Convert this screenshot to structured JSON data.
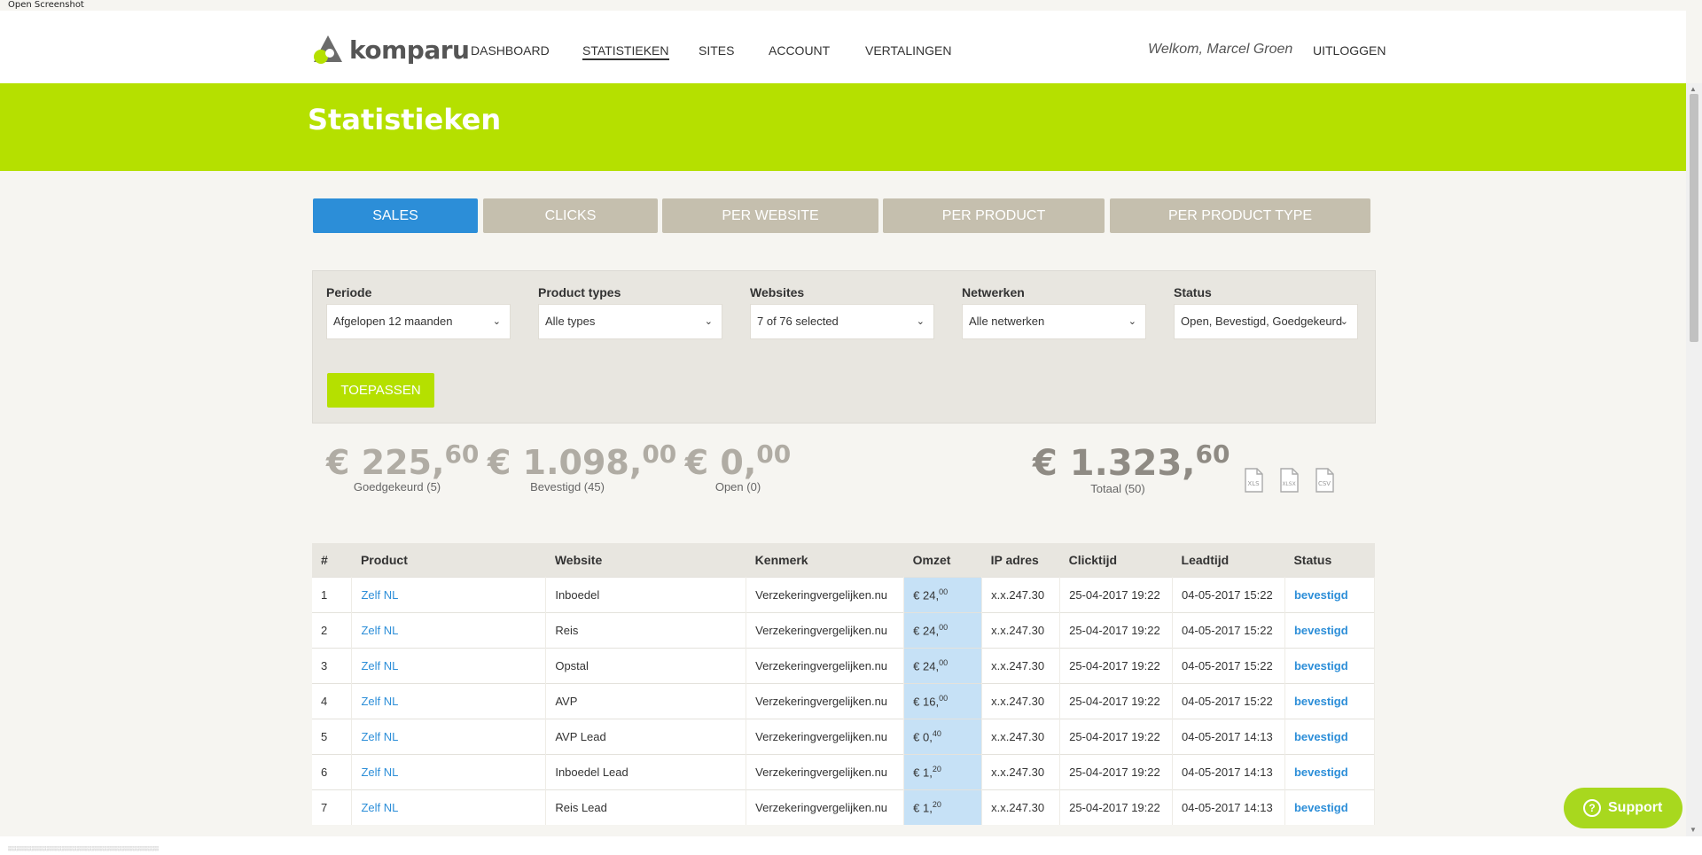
{
  "screenshot_caption": "Open Screenshot",
  "logo": {
    "text": "komparu"
  },
  "nav": {
    "items": [
      {
        "label": "DASHBOARD"
      },
      {
        "label": "STATISTIEKEN"
      },
      {
        "label": "SITES"
      },
      {
        "label": "ACCOUNT"
      },
      {
        "label": "VERTALINGEN"
      }
    ],
    "welcome": "Welkom, Marcel Groen",
    "logout": "UITLOGGEN"
  },
  "page_title": "Statistieken",
  "tabs": [
    {
      "label": "SALES"
    },
    {
      "label": "CLICKS"
    },
    {
      "label": "PER WEBSITE"
    },
    {
      "label": "PER PRODUCT"
    },
    {
      "label": "PER PRODUCT TYPE"
    }
  ],
  "filters": [
    {
      "label": "Periode",
      "value": "Afgelopen 12 maanden"
    },
    {
      "label": "Product types",
      "value": "Alle types"
    },
    {
      "label": "Websites",
      "value": "7 of 76 selected"
    },
    {
      "label": "Netwerken",
      "value": "Alle netwerken"
    },
    {
      "label": "Status",
      "value": "Open, Bevestigd, Goedgekeurd"
    }
  ],
  "apply_label": "TOEPASSEN",
  "summary": [
    {
      "main": "€ 225,",
      "cents": "60",
      "caption": "Goedgekeurd (5)"
    },
    {
      "main": "€ 1.098,",
      "cents": "00",
      "caption": "Bevestigd (45)"
    },
    {
      "main": "€ 0,",
      "cents": "00",
      "caption": "Open (0)"
    },
    {
      "main": "€ 1.323,",
      "cents": "60",
      "caption": "Totaal (50)"
    }
  ],
  "downloads": [
    {
      "label": "XLS"
    },
    {
      "label": "XLSX"
    },
    {
      "label": "CSV"
    }
  ],
  "table": {
    "headers": [
      "#",
      "Product",
      "Website",
      "Kenmerk",
      "Omzet",
      "IP adres",
      "Clicktijd",
      "Leadtijd",
      "Status"
    ],
    "rows": [
      {
        "num": "1",
        "product": "Zelf NL",
        "website": "Inboedel",
        "kenmerk": "Verzekeringvergelijken.nu",
        "omzet": "€ 24,",
        "omzet_cents": "00",
        "ip": "x.x.247.30",
        "click": "25-04-2017 19:22",
        "lead": "04-05-2017 15:22",
        "status": "bevestigd"
      },
      {
        "num": "2",
        "product": "Zelf NL",
        "website": "Reis",
        "kenmerk": "Verzekeringvergelijken.nu",
        "omzet": "€ 24,",
        "omzet_cents": "00",
        "ip": "x.x.247.30",
        "click": "25-04-2017 19:22",
        "lead": "04-05-2017 15:22",
        "status": "bevestigd"
      },
      {
        "num": "3",
        "product": "Zelf NL",
        "website": "Opstal",
        "kenmerk": "Verzekeringvergelijken.nu",
        "omzet": "€ 24,",
        "omzet_cents": "00",
        "ip": "x.x.247.30",
        "click": "25-04-2017 19:22",
        "lead": "04-05-2017 15:22",
        "status": "bevestigd"
      },
      {
        "num": "4",
        "product": "Zelf NL",
        "website": "AVP",
        "kenmerk": "Verzekeringvergelijken.nu",
        "omzet": "€ 16,",
        "omzet_cents": "00",
        "ip": "x.x.247.30",
        "click": "25-04-2017 19:22",
        "lead": "04-05-2017 15:22",
        "status": "bevestigd"
      },
      {
        "num": "5",
        "product": "Zelf NL",
        "website": "AVP Lead",
        "kenmerk": "Verzekeringvergelijken.nu",
        "omzet": "€ 0,",
        "omzet_cents": "40",
        "ip": "x.x.247.30",
        "click": "25-04-2017 19:22",
        "lead": "04-05-2017 14:13",
        "status": "bevestigd"
      },
      {
        "num": "6",
        "product": "Zelf NL",
        "website": "Inboedel Lead",
        "kenmerk": "Verzekeringvergelijken.nu",
        "omzet": "€ 1,",
        "omzet_cents": "20",
        "ip": "x.x.247.30",
        "click": "25-04-2017 19:22",
        "lead": "04-05-2017 14:13",
        "status": "bevestigd"
      },
      {
        "num": "7",
        "product": "Zelf NL",
        "website": "Reis Lead",
        "kenmerk": "Verzekeringvergelijken.nu",
        "omzet": "€ 1,",
        "omzet_cents": "20",
        "ip": "x.x.247.30",
        "click": "25-04-2017 19:22",
        "lead": "04-05-2017 14:13",
        "status": "bevestigd"
      }
    ]
  },
  "support_label": "Support",
  "colors": {
    "accent_green": "#b5e000",
    "active_blue": "#2c8ed8",
    "tab_inactive": "#c5bfae",
    "omzet_highlight": "#c6e1f6"
  }
}
